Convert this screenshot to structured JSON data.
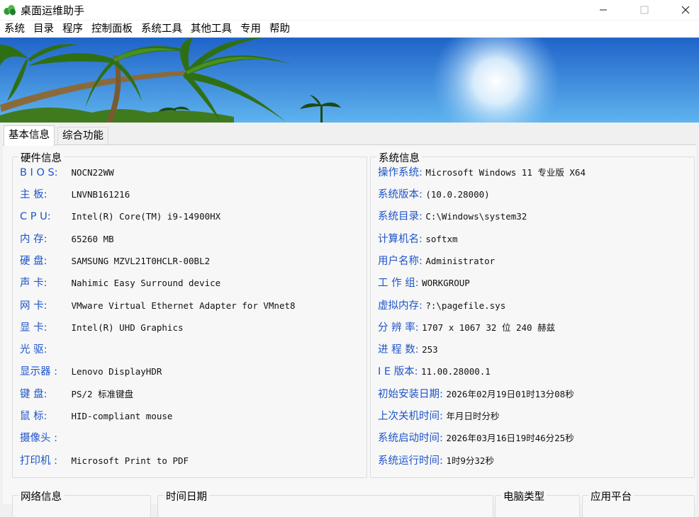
{
  "window": {
    "title": "桌面运维助手"
  },
  "menu": [
    "系统",
    "目录",
    "程序",
    "控制面板",
    "系统工具",
    "其他工具",
    "专用",
    "帮助"
  ],
  "tabs": [
    "基本信息",
    "综合功能"
  ],
  "hardware": {
    "title": "硬件信息",
    "rows": [
      {
        "label": "B I O S:",
        "value": "NOCN22WW"
      },
      {
        "label": "主    板:",
        "value": "LNVNB161216"
      },
      {
        "label": "C  P  U:",
        "value": "Intel(R) Core(TM) i9-14900HX"
      },
      {
        "label": "内    存:",
        "value": "65260 MB"
      },
      {
        "label": "硬    盘:",
        "value": "SAMSUNG MZVL21T0HCLR-00BL2"
      },
      {
        "label": "声    卡:",
        "value": "Nahimic Easy Surround device"
      },
      {
        "label": "网    卡:",
        "value": "VMware Virtual Ethernet Adapter for VMnet8"
      },
      {
        "label": "显    卡:",
        "value": "Intel(R) UHD Graphics"
      },
      {
        "label": "光    驱:",
        "value": ""
      },
      {
        "label": "显示器 :",
        "value": "Lenovo DisplayHDR"
      },
      {
        "label": "键    盘:",
        "value": "PS/2 标准键盘"
      },
      {
        "label": "鼠    标:",
        "value": "HID-compliant mouse"
      },
      {
        "label": "摄像头 :",
        "value": ""
      },
      {
        "label": "打印机 :",
        "value": "Microsoft Print to PDF"
      }
    ]
  },
  "system": {
    "title": "系统信息",
    "rows": [
      {
        "label": "操作系统:",
        "value": "Microsoft Windows 11 专业版 X64"
      },
      {
        "label": "系统版本:",
        "value": " (10.0.28000)"
      },
      {
        "label": "系统目录:",
        "value": "C:\\Windows\\system32"
      },
      {
        "label": "计算机名:",
        "value": "softxm"
      },
      {
        "label": "用户名称:",
        "value": "Administrator"
      },
      {
        "label": "工 作 组:",
        "value": "WORKGROUP"
      },
      {
        "label": "虚拟内存:",
        "value": "?:\\pagefile.sys"
      },
      {
        "label": "分 辨 率:",
        "value": "1707 x 1067 32 位 240 赫兹"
      },
      {
        "label": "进 程 数:",
        "value": "253"
      },
      {
        "label": "I E 版本:",
        "value": "11.00.28000.1"
      },
      {
        "label": "初始安装日期:",
        "value": "2026年02月19日01时13分08秒"
      },
      {
        "label": "上次关机时间:",
        "value": "年月日时分秒"
      },
      {
        "label": "系统启动时间:",
        "value": "2026年03月16日19时46分25秒"
      },
      {
        "label": "系统运行时间:",
        "value": "1时9分32秒"
      }
    ]
  },
  "bottom_groups": [
    "网络信息",
    "时间日期",
    "电脑类型",
    "应用平台"
  ],
  "colors": {
    "label_blue": "#1f55c9",
    "background": "#f0f0f0"
  },
  "icons": [
    "app-leaf-icon",
    "minimize-icon",
    "maximize-icon",
    "close-icon"
  ]
}
